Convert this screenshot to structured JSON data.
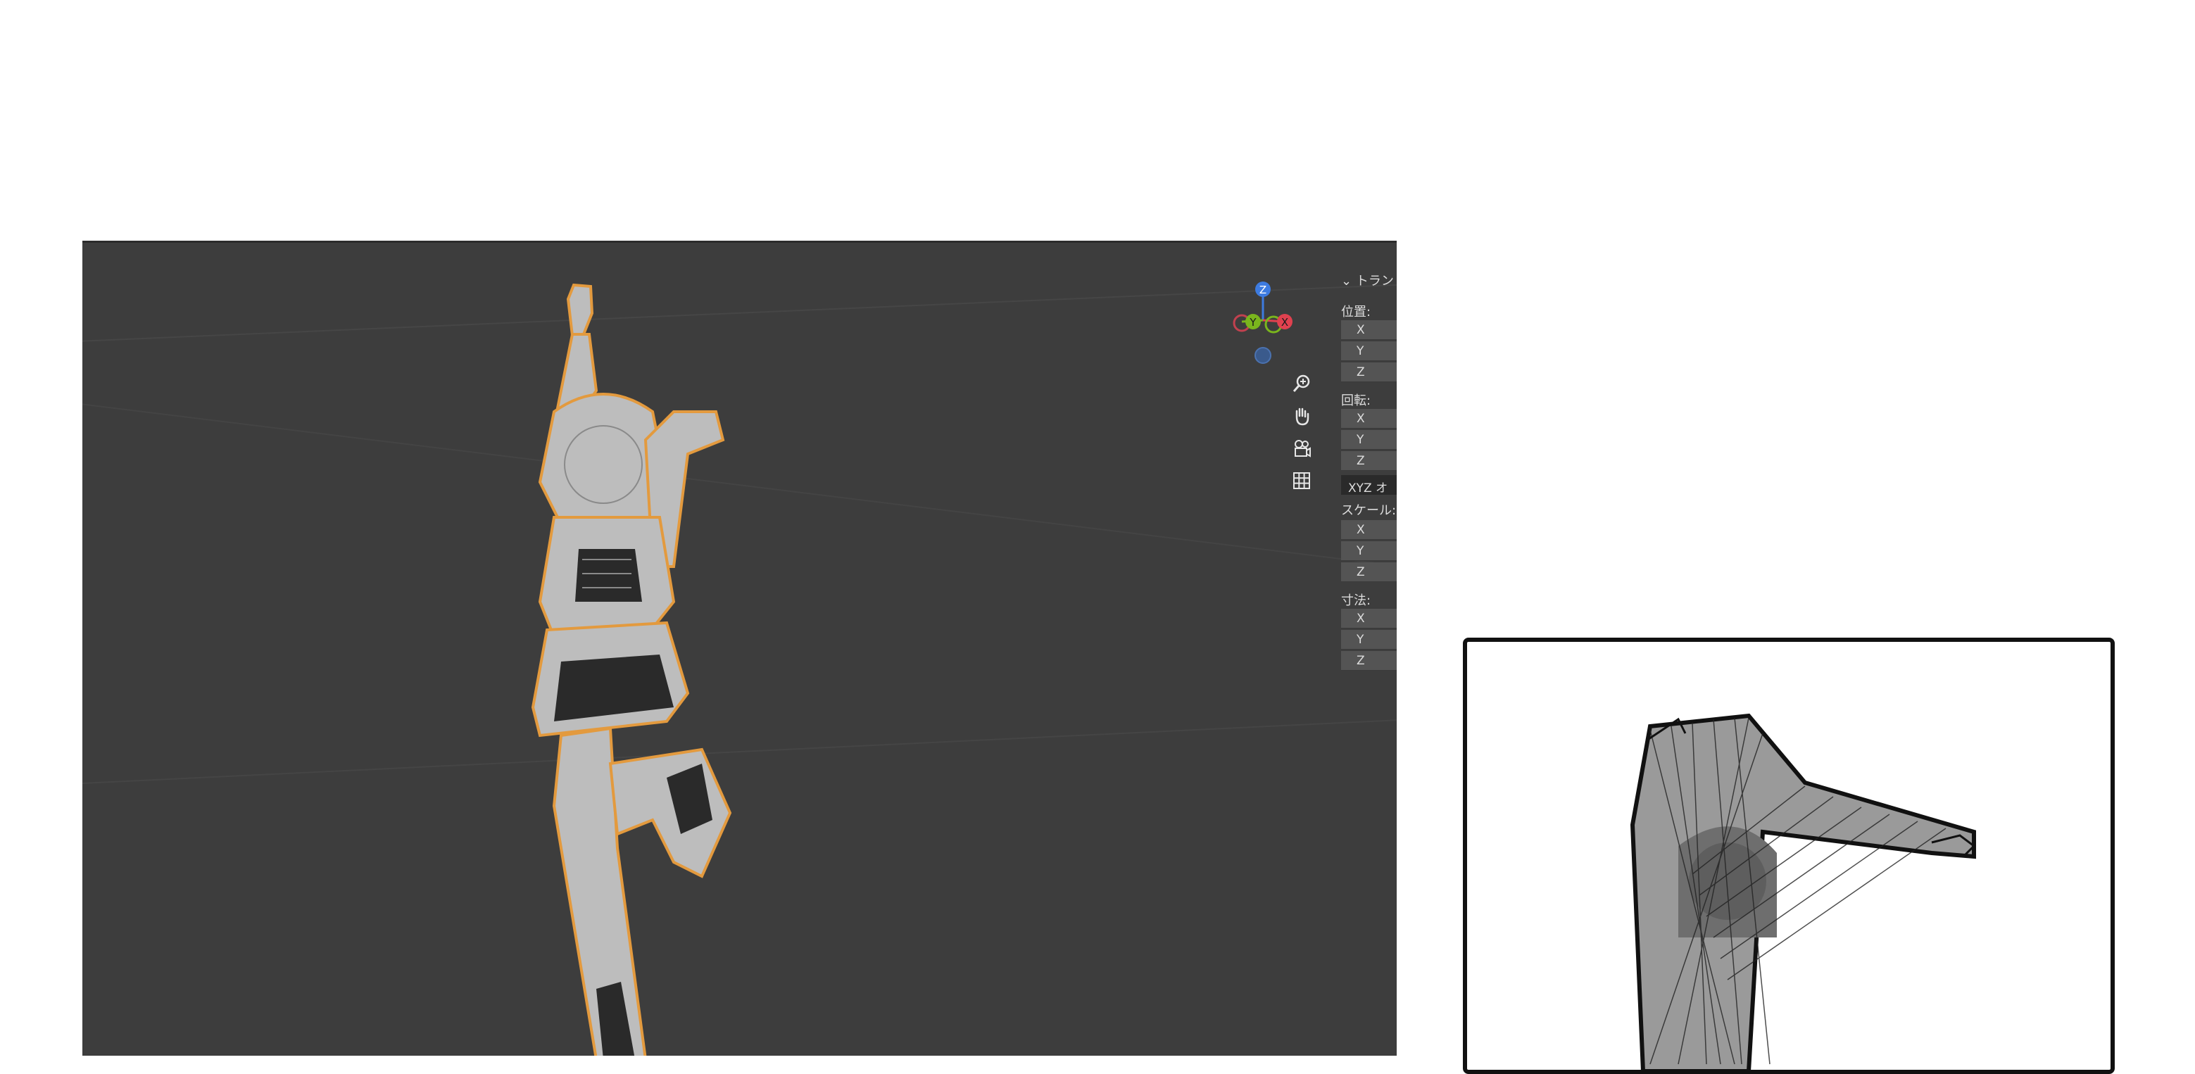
{
  "viewport": {
    "background": "#3d3d3d",
    "gizmo": {
      "z_label": "Z",
      "y_label": "Y",
      "x_label": "X",
      "z_color": "#3d7be0",
      "y_color": "#7ab51d",
      "x_color": "#e0414f"
    },
    "nav_icons": [
      "zoom-icon",
      "hand-icon",
      "camera-icon",
      "grid-icon"
    ]
  },
  "transform_panel": {
    "header": "トラン",
    "location_label": "位置:",
    "rotation_label": "回転:",
    "rotation_mode": "XYZ オ",
    "scale_label": "スケール:",
    "dimensions_label": "寸法:",
    "axes": [
      "X",
      "Y",
      "Z"
    ]
  }
}
